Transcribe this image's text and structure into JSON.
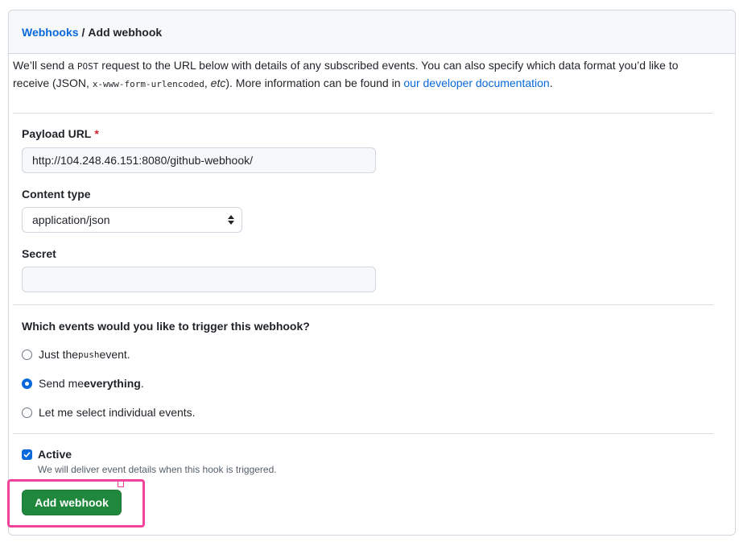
{
  "breadcrumb": {
    "parent": "Webhooks",
    "separator": "/",
    "current": "Add webhook"
  },
  "intro": {
    "part1": "We’ll send a ",
    "method": "POST",
    "part2": " request to the URL below with details of any subscribed events. You can also specify which data format you’d like to receive (JSON, ",
    "format": "x-www-form-urlencoded",
    "part3": ", ",
    "etc": "etc",
    "part4": "). More information can be found in ",
    "link": "our developer documentation",
    "part5": "."
  },
  "payload_url": {
    "label": "Payload URL",
    "required_mark": "*",
    "value": "http://104.248.46.151:8080/github-webhook/"
  },
  "content_type": {
    "label": "Content type",
    "selected": "application/json"
  },
  "secret": {
    "label": "Secret",
    "value": ""
  },
  "events": {
    "question": "Which events would you like to trigger this webhook?",
    "option_push": {
      "prefix": "Just the ",
      "code": "push",
      "suffix": " event."
    },
    "option_everything": {
      "prefix": "Send me ",
      "bold": "everything",
      "suffix": "."
    },
    "option_individual": {
      "label": "Let me select individual events."
    },
    "selected": "everything"
  },
  "active": {
    "label": "Active",
    "checked": true,
    "note": "We will deliver event details when this hook is triggered."
  },
  "submit": {
    "label": "Add webhook"
  },
  "colors": {
    "link": "#0969da",
    "primary_button": "#1f883d",
    "highlight": "#f0449a",
    "required": "#cf222e"
  },
  "icons": {
    "select_arrows": "select-arrows-icon",
    "checkmark": "checkmark-icon"
  }
}
